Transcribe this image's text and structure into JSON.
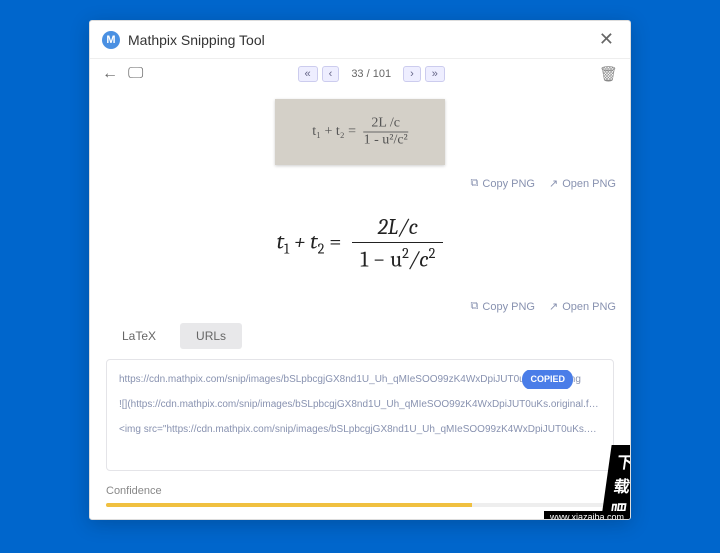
{
  "title": "Mathpix Snipping Tool",
  "pager": {
    "current": 33,
    "total": 101,
    "text": "33 / 101"
  },
  "snip": {
    "handwritten_left": "t₁ + t₂ =",
    "handwritten_num": "2L /c",
    "handwritten_den": "1 - u²/c²"
  },
  "actions": {
    "copy_png": "Copy PNG",
    "open_png": "Open PNG"
  },
  "rendered": {
    "left": "t",
    "sub1": "1",
    "plus": " + t",
    "sub2": "2",
    "eq": " = ",
    "num": "2L/c",
    "den_a": "1 − u",
    "den_sup1": "2",
    "den_b": "/c",
    "den_sup2": "2"
  },
  "tabs": {
    "latex": "LaTeX",
    "urls": "URLs"
  },
  "urls": {
    "line1_a": "https://cdn.mathpix.com/snip/images/bSLpbcgjGX8nd1U_Uh_qMIeSOO99zK4WxDpiJUT0uKs.orig",
    "line1_b": "e.png",
    "chip": "COPIED",
    "line2": "![](https://cdn.mathpix.com/snip/images/bSLpbcgjGX8nd1U_Uh_qMIeSOO99zK4WxDpiJUT0uKs.original.fullsize.png)",
    "line3": "<img src=\"https://cdn.mathpix.com/snip/images/bSLpbcgjGX8nd1U_Uh_qMIeSOO99zK4WxDpiJUT0uKs.original.fullsiz"
  },
  "confidence": {
    "label": "Confidence"
  },
  "watermark": {
    "main": "下载吧",
    "sub": "www.xiazaiba.com"
  }
}
